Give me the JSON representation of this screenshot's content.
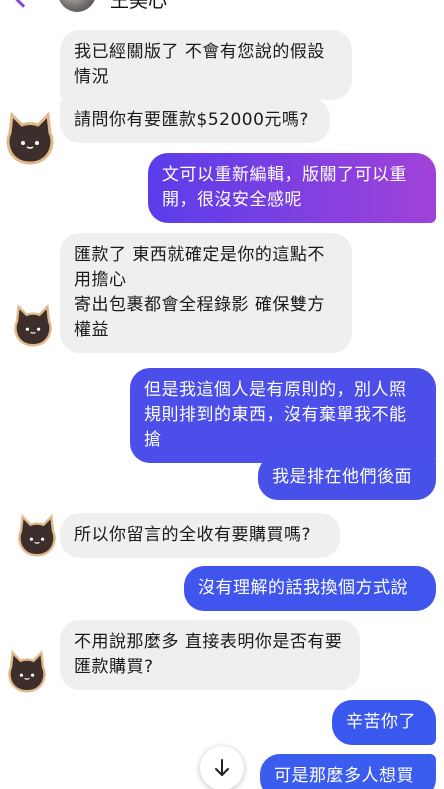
{
  "header": {
    "contact_name": "王美心"
  },
  "icons": {
    "back": "chevron-left-icon",
    "scroll": "arrow-down-icon",
    "avatar": "cat-avatar-icon"
  },
  "colors": {
    "incoming_bubble": "#efefef",
    "outgoing_bubble_start": "#5a3dea",
    "outgoing_bubble_end": "#a042d8",
    "outgoing_bubble_blue": "#3f55ee"
  },
  "messages": [
    {
      "from": "contact",
      "text": "我已經關版了 不會有您說的假設情況"
    },
    {
      "from": "contact",
      "text": "請問你有要匯款$52000元嗎?"
    },
    {
      "from": "me",
      "text": "文可以重新編輯，版關了可以重開，很沒安全感呢"
    },
    {
      "from": "contact",
      "text": "匯款了 東西就確定是你的這點不用擔心\n寄出包裹都會全程錄影 確保雙方權益"
    },
    {
      "from": "me",
      "text": "但是我這個人是有原則的，別人照規則排到的東西，沒有棄單我不能搶"
    },
    {
      "from": "me",
      "text": "我是排在他們後面"
    },
    {
      "from": "contact",
      "text": "所以你留言的全收有要購買嗎?"
    },
    {
      "from": "me",
      "text": "沒有理解的話我換個方式說"
    },
    {
      "from": "contact",
      "text": "不用說那麼多 直接表明你是否有要匯款購買?"
    },
    {
      "from": "me",
      "text": "辛苦你了"
    },
    {
      "from": "me",
      "text": "可是那麼多人想買"
    }
  ]
}
